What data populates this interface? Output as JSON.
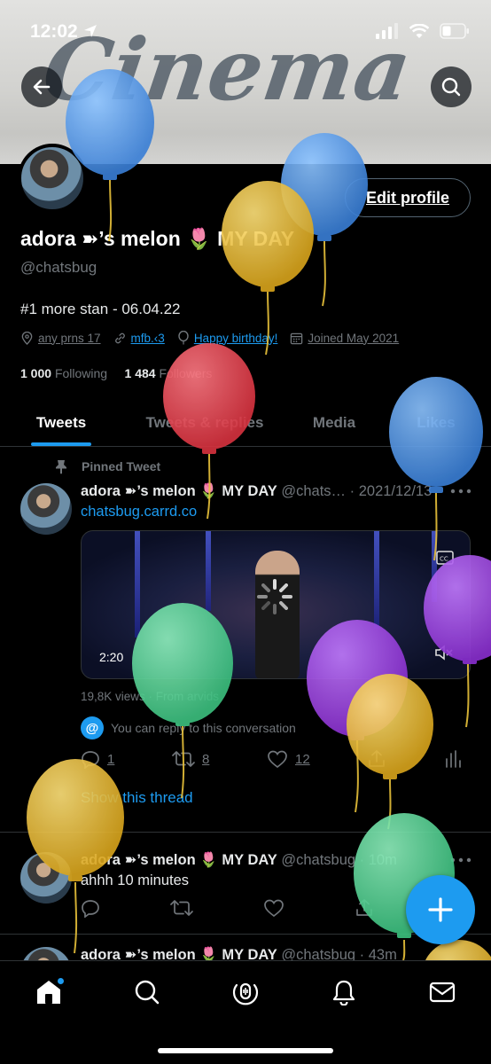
{
  "status_bar": {
    "time": "12:02"
  },
  "header": {
    "banner_text": "Cinema"
  },
  "profile": {
    "display_name": "adora ➽’s melon",
    "name_emoji": "🌷",
    "name_suffix": "MY DAY",
    "handle": "@chatsbug",
    "bio": "#1 more stan - 06.04.22",
    "location": "any prns 17",
    "website": "mfb.‹3",
    "birthday": "Happy birthday!",
    "joined": "Joined May 2021",
    "following_count": "1 000",
    "following_label": "Following",
    "followers_count": "1 484",
    "followers_label": "Followers",
    "edit_button": "Edit profile"
  },
  "tabs": [
    "Tweets",
    "Tweets & replies",
    "Media",
    "Likes"
  ],
  "pinned_label": "Pinned Tweet",
  "tweets": [
    {
      "name": "adora ➽’s melon",
      "emoji": "🌷",
      "name_suffix": "MY DAY",
      "handle_time": "@chats… · 2021/12/13",
      "link": "chatsbug.carrd.co",
      "video_duration": "2:20",
      "views": "19,8K views · From arvids",
      "reply_note": "You can reply to this conversation",
      "replies": "1",
      "retweets": "8",
      "likes": "12",
      "show_thread": "Show this thread"
    },
    {
      "name": "adora ➽’s melon",
      "emoji": "🌷",
      "name_suffix": "MY DAY",
      "handle_time": "@chatsbug · 10m",
      "text": "ahhh 10 minutes"
    },
    {
      "name": "adora ➽’s melon",
      "emoji": "🌷",
      "name_suffix": "MY DAY",
      "handle_time": "@chatsbug · 43m"
    }
  ],
  "colors": {
    "accent": "#1d9bf0",
    "background": "#000000",
    "muted": "#71767b",
    "balloon_blue": "#4a90e2",
    "balloon_yellow": "#e8b92a",
    "balloon_red": "#e0444f",
    "balloon_green": "#4fd08f",
    "balloon_purple": "#9b3fd8"
  },
  "icons": [
    "back-arrow-icon",
    "search-icon",
    "location-icon",
    "link-icon",
    "balloon-icon",
    "calendar-icon",
    "pin-icon",
    "reply-icon",
    "retweet-icon",
    "like-icon",
    "share-icon",
    "analytics-icon",
    "compose-plus-icon",
    "home-icon",
    "explore-icon",
    "spaces-icon",
    "notifications-icon",
    "messages-icon"
  ]
}
